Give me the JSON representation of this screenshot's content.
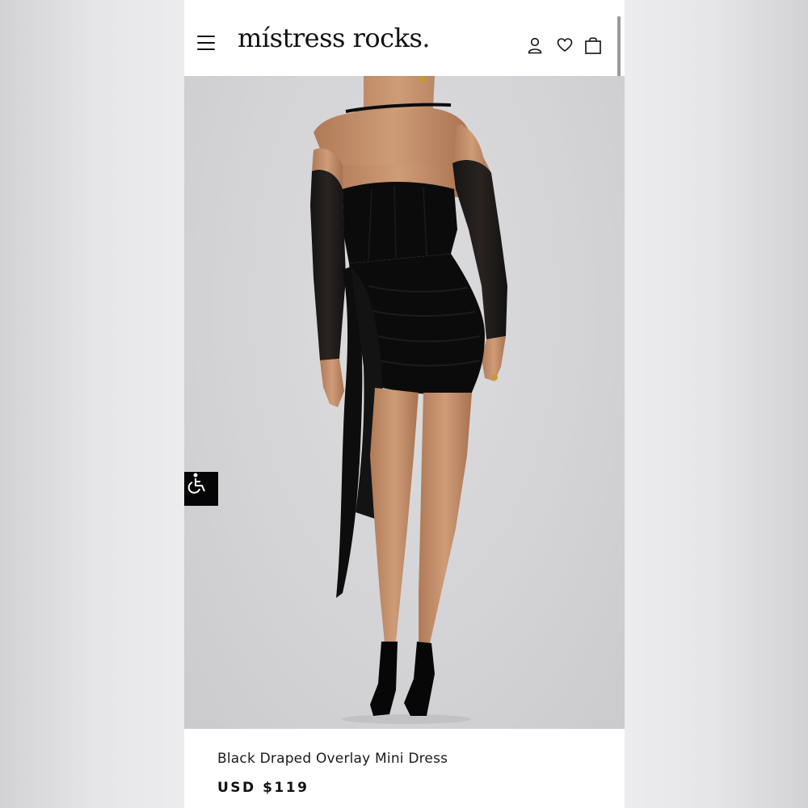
{
  "header": {
    "logo_text": "místress rocks.",
    "icons": {
      "menu": "hamburger-menu-icon",
      "account": "user-icon",
      "wishlist": "heart-icon",
      "cart": "shopping-bag-icon"
    }
  },
  "hero": {
    "image_label": "product-photo"
  },
  "accessibility": {
    "icon": "wheelchair-accessibility-icon"
  },
  "product": {
    "title": "Black Draped Overlay Mini Dress",
    "currency": "USD",
    "price": "$119"
  },
  "colors": {
    "background": "#ececee",
    "text": "#111111",
    "dress": "#0b0b0c",
    "skin": "#c48f6a"
  }
}
